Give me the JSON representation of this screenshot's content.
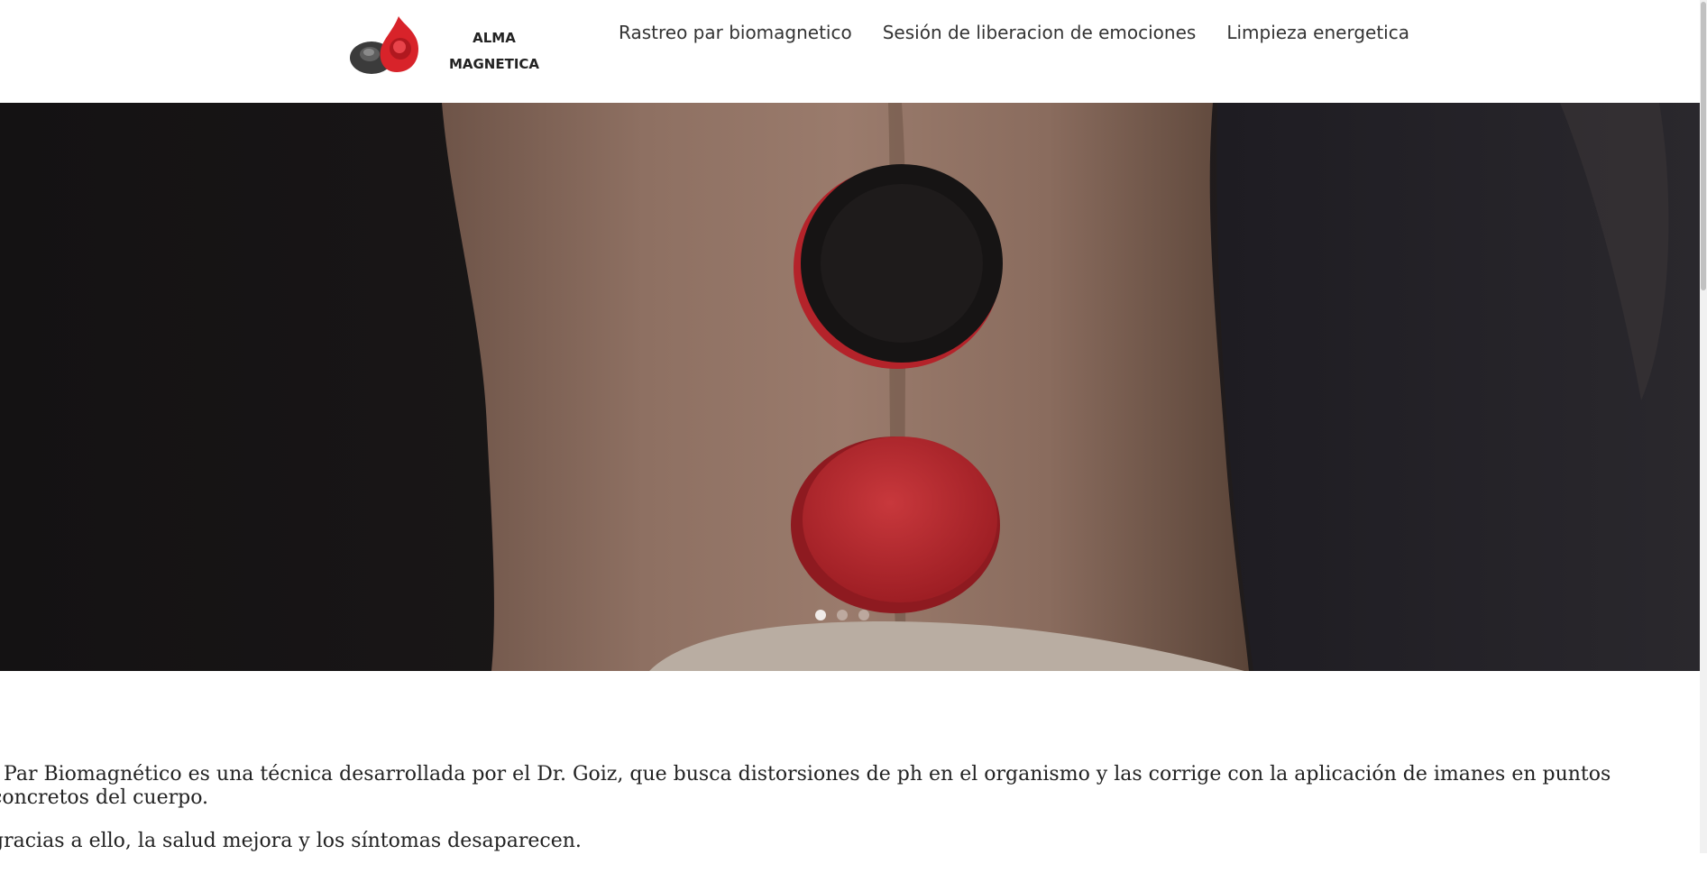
{
  "brand": {
    "line1": "ALMA",
    "line2": "MAGNETICA",
    "icon": "magnet-pair-icon",
    "colors": {
      "red": "#d8232a",
      "dark": "#3a3a3a"
    }
  },
  "nav": {
    "items": [
      {
        "label": "Rastreo par biomagnetico"
      },
      {
        "label": "Sesión de liberacion de emociones"
      },
      {
        "label": "Limpieza energetica"
      }
    ]
  },
  "hero": {
    "image": "back-with-magnets-photo",
    "slides_total": 3,
    "active_slide": 1
  },
  "content": {
    "paragraphs": [
      "l Par Biomagnético es una técnica desarrollada por el Dr. Goiz, que busca distorsiones de ph en el organismo y las corrige con la aplicación de imanes en puntos concretos del cuerpo.",
      "gracias a ello, la salud mejora y los síntomas desaparecen."
    ]
  }
}
